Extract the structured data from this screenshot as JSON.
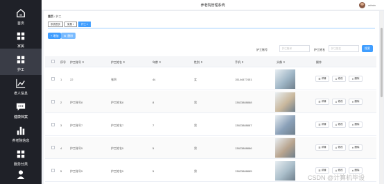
{
  "sidebar": {
    "items": [
      {
        "label": "首页",
        "icon": "home-icon",
        "active": false
      },
      {
        "label": "家属",
        "icon": "grid-icon",
        "active": false
      },
      {
        "label": "护工",
        "icon": "grid-icon",
        "active": true
      },
      {
        "label": "老人信息",
        "icon": "trend-icon",
        "active": false
      },
      {
        "label": "健康档案",
        "icon": "chat-icon",
        "active": false
      },
      {
        "label": "养老院信息",
        "icon": "bar-chart-icon",
        "active": false
      },
      {
        "label": "服务分类",
        "icon": "grid-icon",
        "active": false
      },
      {
        "label": "",
        "icon": "user-icon",
        "active": false
      }
    ]
  },
  "header": {
    "title": "养老院管理系统",
    "user": "admin"
  },
  "breadcrumb": {
    "home": "首页",
    "current": "护工"
  },
  "tabs": [
    "系统首页",
    "家属 ×",
    "护工 ×"
  ],
  "toolbar": {
    "add": "+ 增加",
    "delete": "删除"
  },
  "search": {
    "field1_label": "护工账号",
    "field1_placeholder": "护工账号",
    "field2_label": "护工姓名",
    "field2_placeholder": "护工姓名",
    "button": "搜索"
  },
  "table": {
    "headers": [
      "序号",
      "护工账号 ⇕",
      "护工姓名 ⇕",
      "年龄 ⇕",
      "性别 ⇕",
      "手机 ⇕",
      "头像 ⇕",
      "操作"
    ],
    "rows": [
      {
        "index": "1",
        "account": "22",
        "name": "张四",
        "age": "44",
        "gender": "女",
        "phone": "15144477451",
        "photo_bg": "#9fb6c6"
      },
      {
        "index": "2",
        "account": "护工账号8",
        "name": "护工姓名8",
        "age": "8",
        "gender": "男",
        "phone": "13823888888",
        "photo_bg": "#c9b79c"
      },
      {
        "index": "3",
        "account": "护工账号7",
        "name": "护工姓名7",
        "age": "7",
        "gender": "男",
        "phone": "13823888887",
        "photo_bg": "#8aa0b8"
      },
      {
        "index": "4",
        "account": "护工账号5",
        "name": "护工姓名5",
        "age": "5",
        "gender": "男",
        "phone": "13823888886",
        "photo_bg": "#b8a48e"
      },
      {
        "index": "5",
        "account": "护工账号5",
        "name": "护工姓名5",
        "age": "5",
        "gender": "男",
        "phone": "13823888885",
        "photo_bg": "#a9bdc9"
      }
    ],
    "actions": [
      "详情",
      "修改",
      "删除"
    ]
  },
  "watermark": "CSDN @计算机毕设"
}
